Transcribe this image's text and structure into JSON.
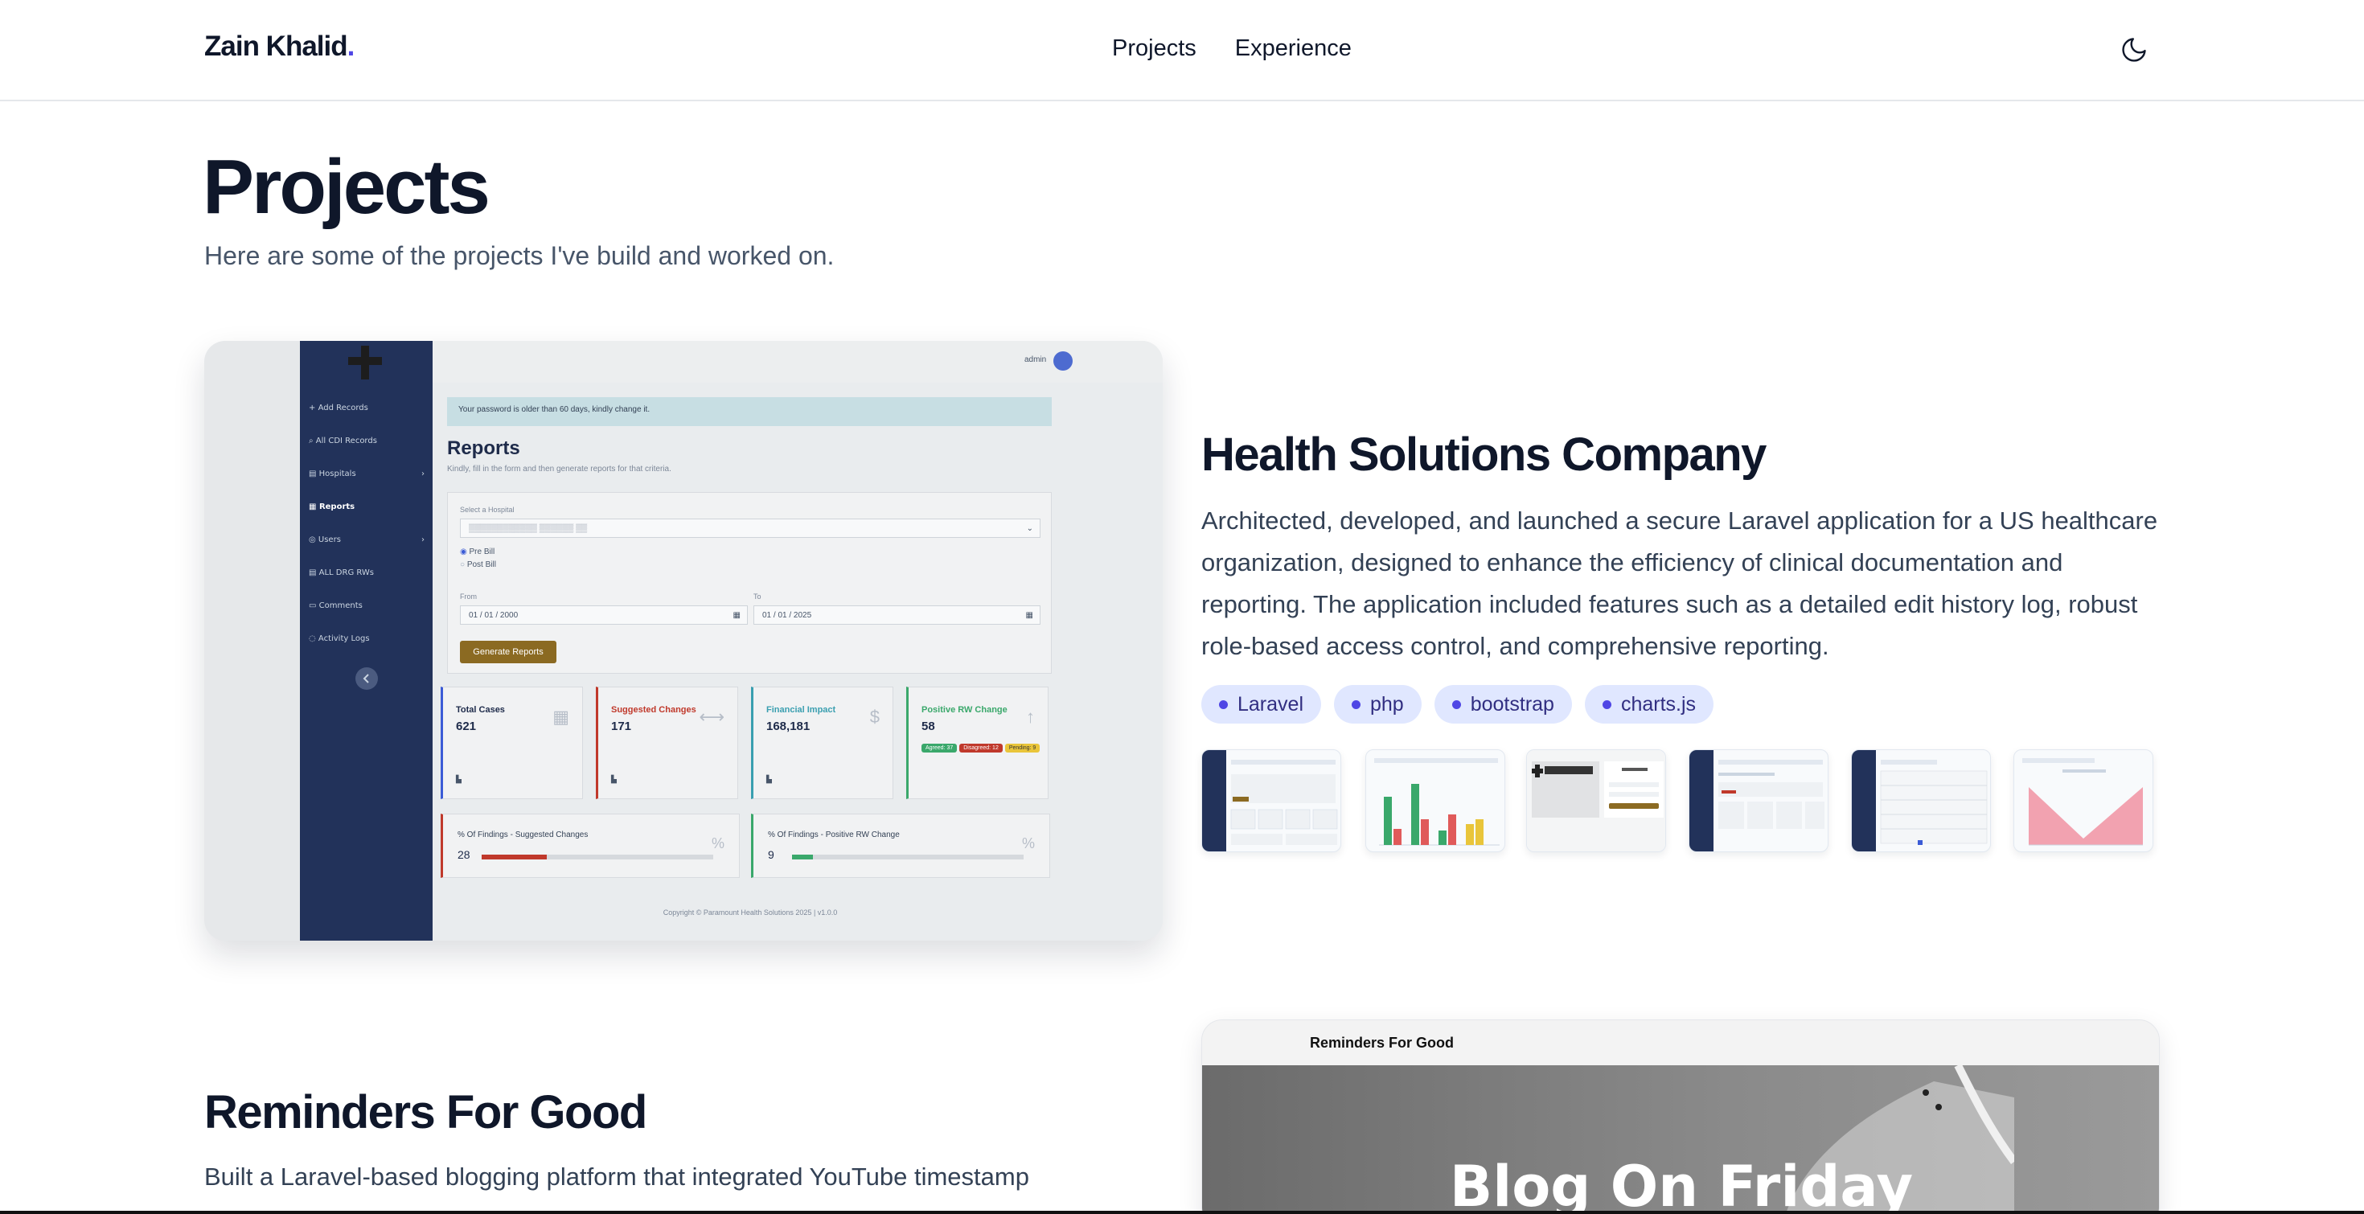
{
  "header": {
    "brand": "Zain Khalid",
    "brand_dot": ".",
    "nav": [
      "Projects",
      "Experience"
    ],
    "theme_toggle_icon": "moon-icon"
  },
  "intro": {
    "title": "Projects",
    "subtitle": "Here are some of the projects I've build and worked on."
  },
  "projects": [
    {
      "title": "Health Solutions Company",
      "description": "Architected, developed, and launched a secure Laravel application for a US healthcare organization, designed to enhance the efficiency of clinical documentation and reporting. The application included features such as a detailed edit history log, robust role-based access control, and comprehensive reporting.",
      "tags": [
        "Laravel",
        "php",
        "bootstrap",
        "charts.js"
      ],
      "screenshot": {
        "sidebar": [
          "Add Records",
          "All CDI Records",
          "Hospitals",
          "Reports",
          "Users",
          "ALL DRG RWs",
          "Comments",
          "Activity Logs"
        ],
        "active_item": "Reports",
        "user": "admin",
        "alert": "Your password is older than 60 days, kindly change it.",
        "heading": "Reports",
        "subheading": "Kindly, fill in the form and then generate reports for that criteria.",
        "hospital_label": "Select a Hospital",
        "radio_pre": "Pre Bill",
        "radio_post": "Post Bill",
        "from_label": "From",
        "from_value": "01 / 01 / 2000",
        "to_label": "To",
        "to_value": "01 / 01 / 2025",
        "generate_button": "Generate Reports",
        "stats": [
          {
            "label": "Total Cases",
            "value": "621",
            "color": "#1e2b4a"
          },
          {
            "label": "Suggested Changes",
            "value": "171",
            "color": "#c0392b"
          },
          {
            "label": "Financial Impact",
            "value": "168,181",
            "color": "#3a9fb0"
          },
          {
            "label": "Positive RW Change",
            "value": "58",
            "color": "#3aa86b"
          }
        ],
        "rw_pills": [
          "Agreed: 37",
          "Disagreed: 12",
          "Pending: 9"
        ],
        "findings": [
          {
            "label": "% Of Findings - Suggested Changes",
            "value": "28",
            "fraction": 0.28,
            "color": "#c0392b"
          },
          {
            "label": "% Of Findings - Positive RW Change",
            "value": "9",
            "fraction": 0.09,
            "color": "#3aa86b"
          }
        ],
        "footer": "Copyright © Paramount Health Solutions 2025 | v1.0.0"
      },
      "gallery_count": 6
    },
    {
      "title": "Reminders For Good",
      "description": "Built a Laravel-based blogging platform that integrated YouTube timestamp",
      "screenshot": {
        "site_name": "Reminders For Good",
        "hero_text": "Blog On Friday"
      }
    }
  ],
  "colors": {
    "accent": "#4f46e5",
    "tag_bg": "#e0e7ff",
    "tag_text": "#312e81",
    "sidebar": "#22325a",
    "gold_button": "#8b6a22"
  }
}
